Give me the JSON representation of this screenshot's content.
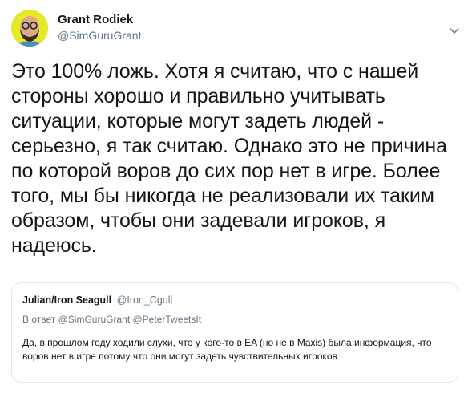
{
  "author": {
    "display_name": "Grant Rodiek",
    "handle": "@SimGuruGrant"
  },
  "tweet": {
    "text": "Это 100% ложь. Хотя я считаю, что с нашей стороны хорошо и правильно учитывать ситуации, которые могут задеть людей - серьезно, я так считаю. Однако это не причина по которой воров до сих пор нет в игре. Более того, мы бы никогда не реализовали их таким образом, чтобы они задевали игроков, я надеюсь."
  },
  "quoted_tweet": {
    "display_name": "Julian/Iron Seagull",
    "handle": "@Iron_Cgull",
    "reply_prefix": "В ответ",
    "reply_to": [
      "@SimGuruGrant",
      "@PeterTweetsIt"
    ],
    "text": "Да, в прошлом году ходили слухи, что у кого-то в EA (но не в Maxis) была информация, что воров нет в игре потому что они могут задеть чувствительных игроков"
  },
  "icons": {
    "menu": "chevron-down-icon",
    "avatar": "avatar"
  },
  "colors": {
    "text_primary": "#14171a",
    "text_secondary": "#657786",
    "border": "#e1e8ed",
    "avatar_bg": "#e6e92a"
  }
}
